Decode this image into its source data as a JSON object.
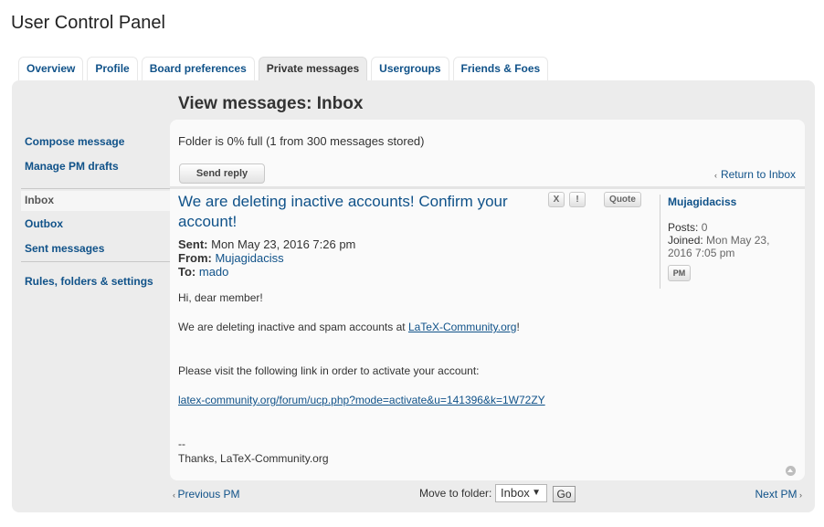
{
  "page": {
    "title": "User Control Panel"
  },
  "tabs": [
    {
      "label": "Overview",
      "active": false
    },
    {
      "label": "Profile",
      "active": false
    },
    {
      "label": "Board preferences",
      "active": false
    },
    {
      "label": "Private messages",
      "active": true
    },
    {
      "label": "Usergroups",
      "active": false
    },
    {
      "label": "Friends & Foes",
      "active": false
    }
  ],
  "sidebar": {
    "compose": "Compose message",
    "drafts": "Manage PM drafts",
    "inbox": "Inbox",
    "outbox": "Outbox",
    "sent": "Sent messages",
    "rules": "Rules, folders & settings"
  },
  "main": {
    "section_title": "View messages: Inbox",
    "folder_status": "Folder is 0% full (1 from 300 messages stored)",
    "send_reply": "Send reply",
    "return_link": "Return to Inbox"
  },
  "message": {
    "title": "We are deleting inactive accounts! Confirm your account!",
    "buttons": {
      "delete": "X",
      "report": "!",
      "quote": "Quote"
    },
    "sent_label": "Sent:",
    "sent_value": "Mon May 23, 2016 7:26 pm",
    "from_label": "From:",
    "from_value": "Mujagidaciss",
    "to_label": "To:",
    "to_value": "mado",
    "body": {
      "greeting": "Hi, dear member!",
      "line1_prefix": "We are deleting inactive and spam accounts at ",
      "line1_link": "LaTeX-Community.org",
      "line1_suffix": "!",
      "line2": "Please visit the following link in order to activate your account:",
      "activation_link": "latex-community.org/forum/ucp.php?mode=activate&u=141396&k=1W72ZY",
      "sig_sep": "--",
      "signoff": "Thanks, LaTeX-Community.org"
    }
  },
  "author": {
    "name": "Mujagidaciss",
    "posts_label": "Posts:",
    "posts_value": "0",
    "joined_label": "Joined:",
    "joined_value": "Mon May 23, 2016 7:05 pm",
    "pm_button": "PM"
  },
  "footer": {
    "prev": "Previous PM",
    "next": "Next PM",
    "move_label": "Move to folder:",
    "folder_selected": "Inbox",
    "go": "Go"
  },
  "colors": {
    "link": "#105289",
    "panel": "#ececec",
    "content": "#fafafa"
  }
}
